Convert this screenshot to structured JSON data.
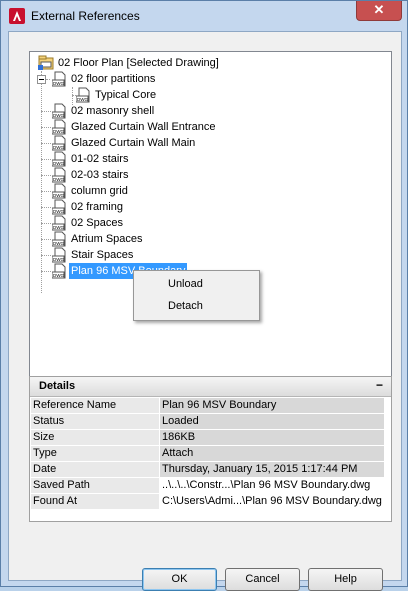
{
  "window": {
    "title": "External References",
    "close_label": "✕"
  },
  "tree": {
    "root": {
      "label": "02 Floor Plan [Selected Drawing]",
      "icon": "drawing-root-icon"
    },
    "nodes": [
      {
        "label": "02 floor partitions",
        "expanded": true
      },
      {
        "label": "Typical Core",
        "child": true
      },
      {
        "label": "02 masonry shell"
      },
      {
        "label": "Glazed Curtain Wall Entrance"
      },
      {
        "label": "Glazed Curtain Wall Main"
      },
      {
        "label": "01-02 stairs"
      },
      {
        "label": "02-03 stairs"
      },
      {
        "label": "column grid"
      },
      {
        "label": "02 framing"
      },
      {
        "label": "02 Spaces"
      },
      {
        "label": "Atrium Spaces"
      },
      {
        "label": "Stair Spaces"
      },
      {
        "label": "Plan 96 MSV Boundary",
        "selected": true
      }
    ],
    "dwg_icon_text": "DWG"
  },
  "context_menu": {
    "items": [
      "Unload",
      "Detach"
    ]
  },
  "details": {
    "title": "Details",
    "collapse_label": "−",
    "rows": [
      {
        "key": "Reference Name",
        "value": "Plan 96 MSV Boundary"
      },
      {
        "key": "Status",
        "value": "Loaded"
      },
      {
        "key": "Size",
        "value": "186KB"
      },
      {
        "key": "Type",
        "value": "Attach"
      },
      {
        "key": "Date",
        "value": "Thursday, January 15, 2015  1:17:44 PM"
      },
      {
        "key": "Saved Path",
        "value": "..\\..\\..\\Constr...\\Plan 96 MSV Boundary.dwg"
      },
      {
        "key": "Found At",
        "value": "C:\\Users\\Admi...\\Plan 96 MSV Boundary.dwg"
      }
    ]
  },
  "buttons": {
    "ok": "OK",
    "cancel": "Cancel",
    "help": "Help"
  }
}
